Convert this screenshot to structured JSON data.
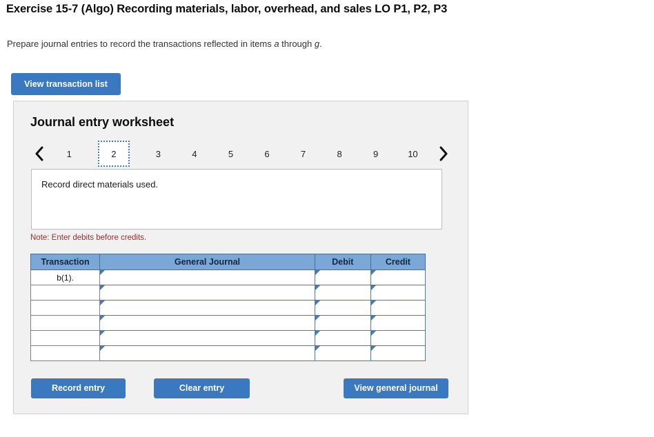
{
  "header": {
    "title": "Exercise 15-7 (Algo) Recording materials, labor, overhead, and sales LO P1, P2, P3",
    "subtitle_before": "Prepare journal entries to record the transactions reflected in items ",
    "subtitle_italic_1": "a",
    "subtitle_middle": " through ",
    "subtitle_italic_2": "g",
    "subtitle_after": "."
  },
  "toolbar": {
    "view_transaction_list_label": "View transaction list"
  },
  "worksheet": {
    "title": "Journal entry worksheet",
    "pager": {
      "prev_icon": "chevron-left-icon",
      "next_icon": "chevron-right-icon",
      "pages": [
        "1",
        "2",
        "3",
        "4",
        "5",
        "6",
        "7",
        "8",
        "9",
        "10"
      ],
      "active_page": "2"
    },
    "prompt": "Record direct materials used.",
    "note": "Note: Enter debits before credits.",
    "table": {
      "columns": [
        "Transaction",
        "General Journal",
        "Debit",
        "Credit"
      ],
      "rows": [
        {
          "transaction": "b(1).",
          "general_journal": "",
          "debit": "",
          "credit": ""
        },
        {
          "transaction": "",
          "general_journal": "",
          "debit": "",
          "credit": ""
        },
        {
          "transaction": "",
          "general_journal": "",
          "debit": "",
          "credit": ""
        },
        {
          "transaction": "",
          "general_journal": "",
          "debit": "",
          "credit": ""
        },
        {
          "transaction": "",
          "general_journal": "",
          "debit": "",
          "credit": ""
        },
        {
          "transaction": "",
          "general_journal": "",
          "debit": "",
          "credit": ""
        }
      ]
    },
    "actions": {
      "record_entry_label": "Record entry",
      "clear_entry_label": "Clear entry",
      "view_general_journal_label": "View general journal"
    }
  },
  "colors": {
    "button_blue": "#3a78bf",
    "table_header_blue": "#7ba7d7",
    "input_border_blue": "#4a7ab0",
    "note_red": "#a03030",
    "panel_gray": "#f1f1f1"
  }
}
